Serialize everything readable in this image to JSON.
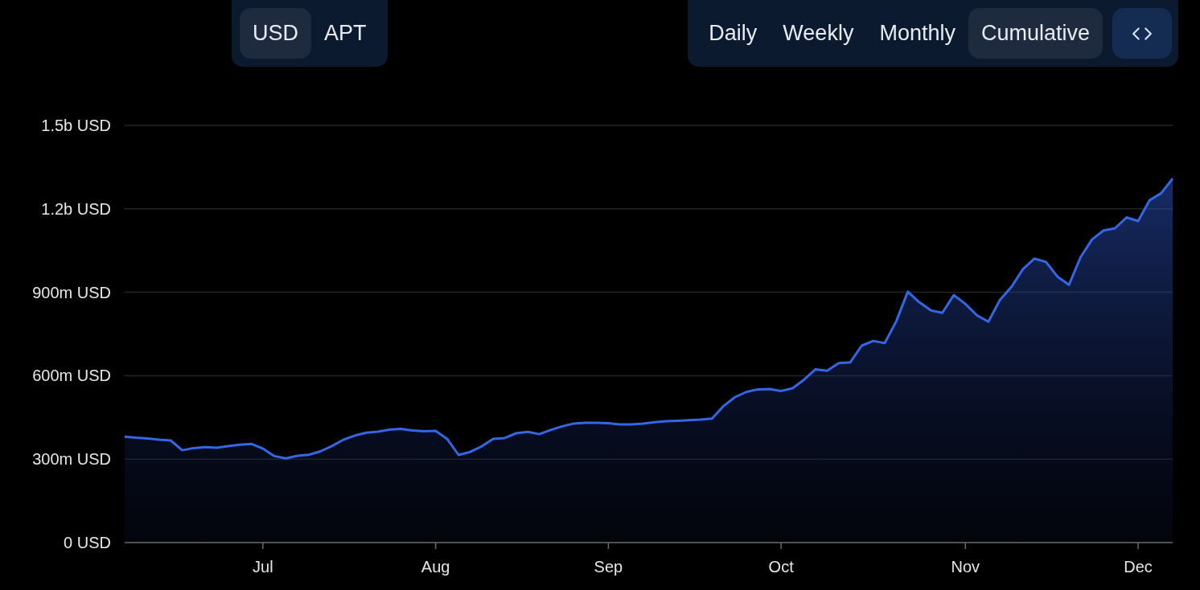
{
  "currency_toggle": [
    {
      "label": "USD",
      "selected": true
    },
    {
      "label": "APT",
      "selected": false
    }
  ],
  "period_toggle": [
    {
      "label": "Daily",
      "selected": false
    },
    {
      "label": "Weekly",
      "selected": false
    },
    {
      "label": "Monthly",
      "selected": false
    },
    {
      "label": "Cumulative",
      "selected": true
    }
  ],
  "chart": {
    "chart_data": {
      "type": "area",
      "grid": true,
      "categories": [
        null,
        null,
        null,
        null,
        null,
        null,
        null,
        null,
        null,
        null,
        null,
        null,
        "Jul",
        null,
        null,
        null,
        null,
        null,
        null,
        null,
        null,
        null,
        null,
        null,
        null,
        null,
        null,
        "Aug",
        null,
        null,
        null,
        null,
        null,
        null,
        null,
        null,
        null,
        null,
        null,
        null,
        null,
        null,
        "Sep",
        null,
        null,
        null,
        null,
        null,
        null,
        null,
        null,
        null,
        null,
        null,
        null,
        null,
        null,
        "Oct",
        null,
        null,
        null,
        null,
        null,
        null,
        null,
        null,
        null,
        null,
        null,
        null,
        null,
        null,
        null,
        "Nov",
        null,
        null,
        null,
        null,
        null,
        null,
        null,
        null,
        null,
        null,
        null,
        null,
        null,
        null,
        "Dec",
        null,
        null,
        null
      ],
      "series": [
        {
          "color": "#3367e6",
          "values": [
            381000000.0,
            377000000.0,
            374000000.0,
            370000000.0,
            367000000.0,
            332000000.0,
            340000000.0,
            343000000.0,
            341000000.0,
            347000000.0,
            352000000.0,
            355000000.0,
            338000000.0,
            311000000.0,
            303000000.0,
            312000000.0,
            316000000.0,
            328000000.0,
            347000000.0,
            370000000.0,
            385000000.0,
            395000000.0,
            399000000.0,
            406000000.0,
            409000000.0,
            403000000.0,
            400000000.0,
            402000000.0,
            373000000.0,
            315000000.0,
            326000000.0,
            346000000.0,
            373000000.0,
            376000000.0,
            393000000.0,
            398000000.0,
            390000000.0,
            405000000.0,
            418000000.0,
            428000000.0,
            431000000.0,
            431000000.0,
            429000000.0,
            425000000.0,
            425000000.0,
            428000000.0,
            433000000.0,
            436000000.0,
            438000000.0,
            440000000.0,
            442000000.0,
            446000000.0,
            491000000.0,
            523000000.0,
            542000000.0,
            551000000.0,
            552000000.0,
            545000000.0,
            555000000.0,
            586000000.0,
            623000000.0,
            618000000.0,
            645000000.0,
            648000000.0,
            708000000.0,
            725000000.0,
            717000000.0,
            796000000.0,
            902000000.0,
            864000000.0,
            835000000.0,
            826000000.0,
            890000000.0,
            858000000.0,
            817000000.0,
            794000000.0,
            872000000.0,
            919000000.0,
            983000000.0,
            1021000000.0,
            1009000000.0,
            956000000.0,
            927000000.0,
            1026000000.0,
            1090000000.0,
            1122000000.0,
            1130000000.0,
            1169000000.0,
            1156000000.0,
            1231000000.0,
            1256000000.0,
            1309000000.0
          ]
        }
      ],
      "ylim": [
        0,
        1500000000.0
      ],
      "yticks": [
        {
          "value": 0,
          "label": "0 USD"
        },
        {
          "value": 300000000.0,
          "label": "300m USD"
        },
        {
          "value": 600000000.0,
          "label": "600m USD"
        },
        {
          "value": 900000000.0,
          "label": "900m USD"
        },
        {
          "value": 1200000000.0,
          "label": "1.2b USD"
        },
        {
          "value": 1500000000.0,
          "label": "1.5b USD"
        }
      ]
    }
  }
}
